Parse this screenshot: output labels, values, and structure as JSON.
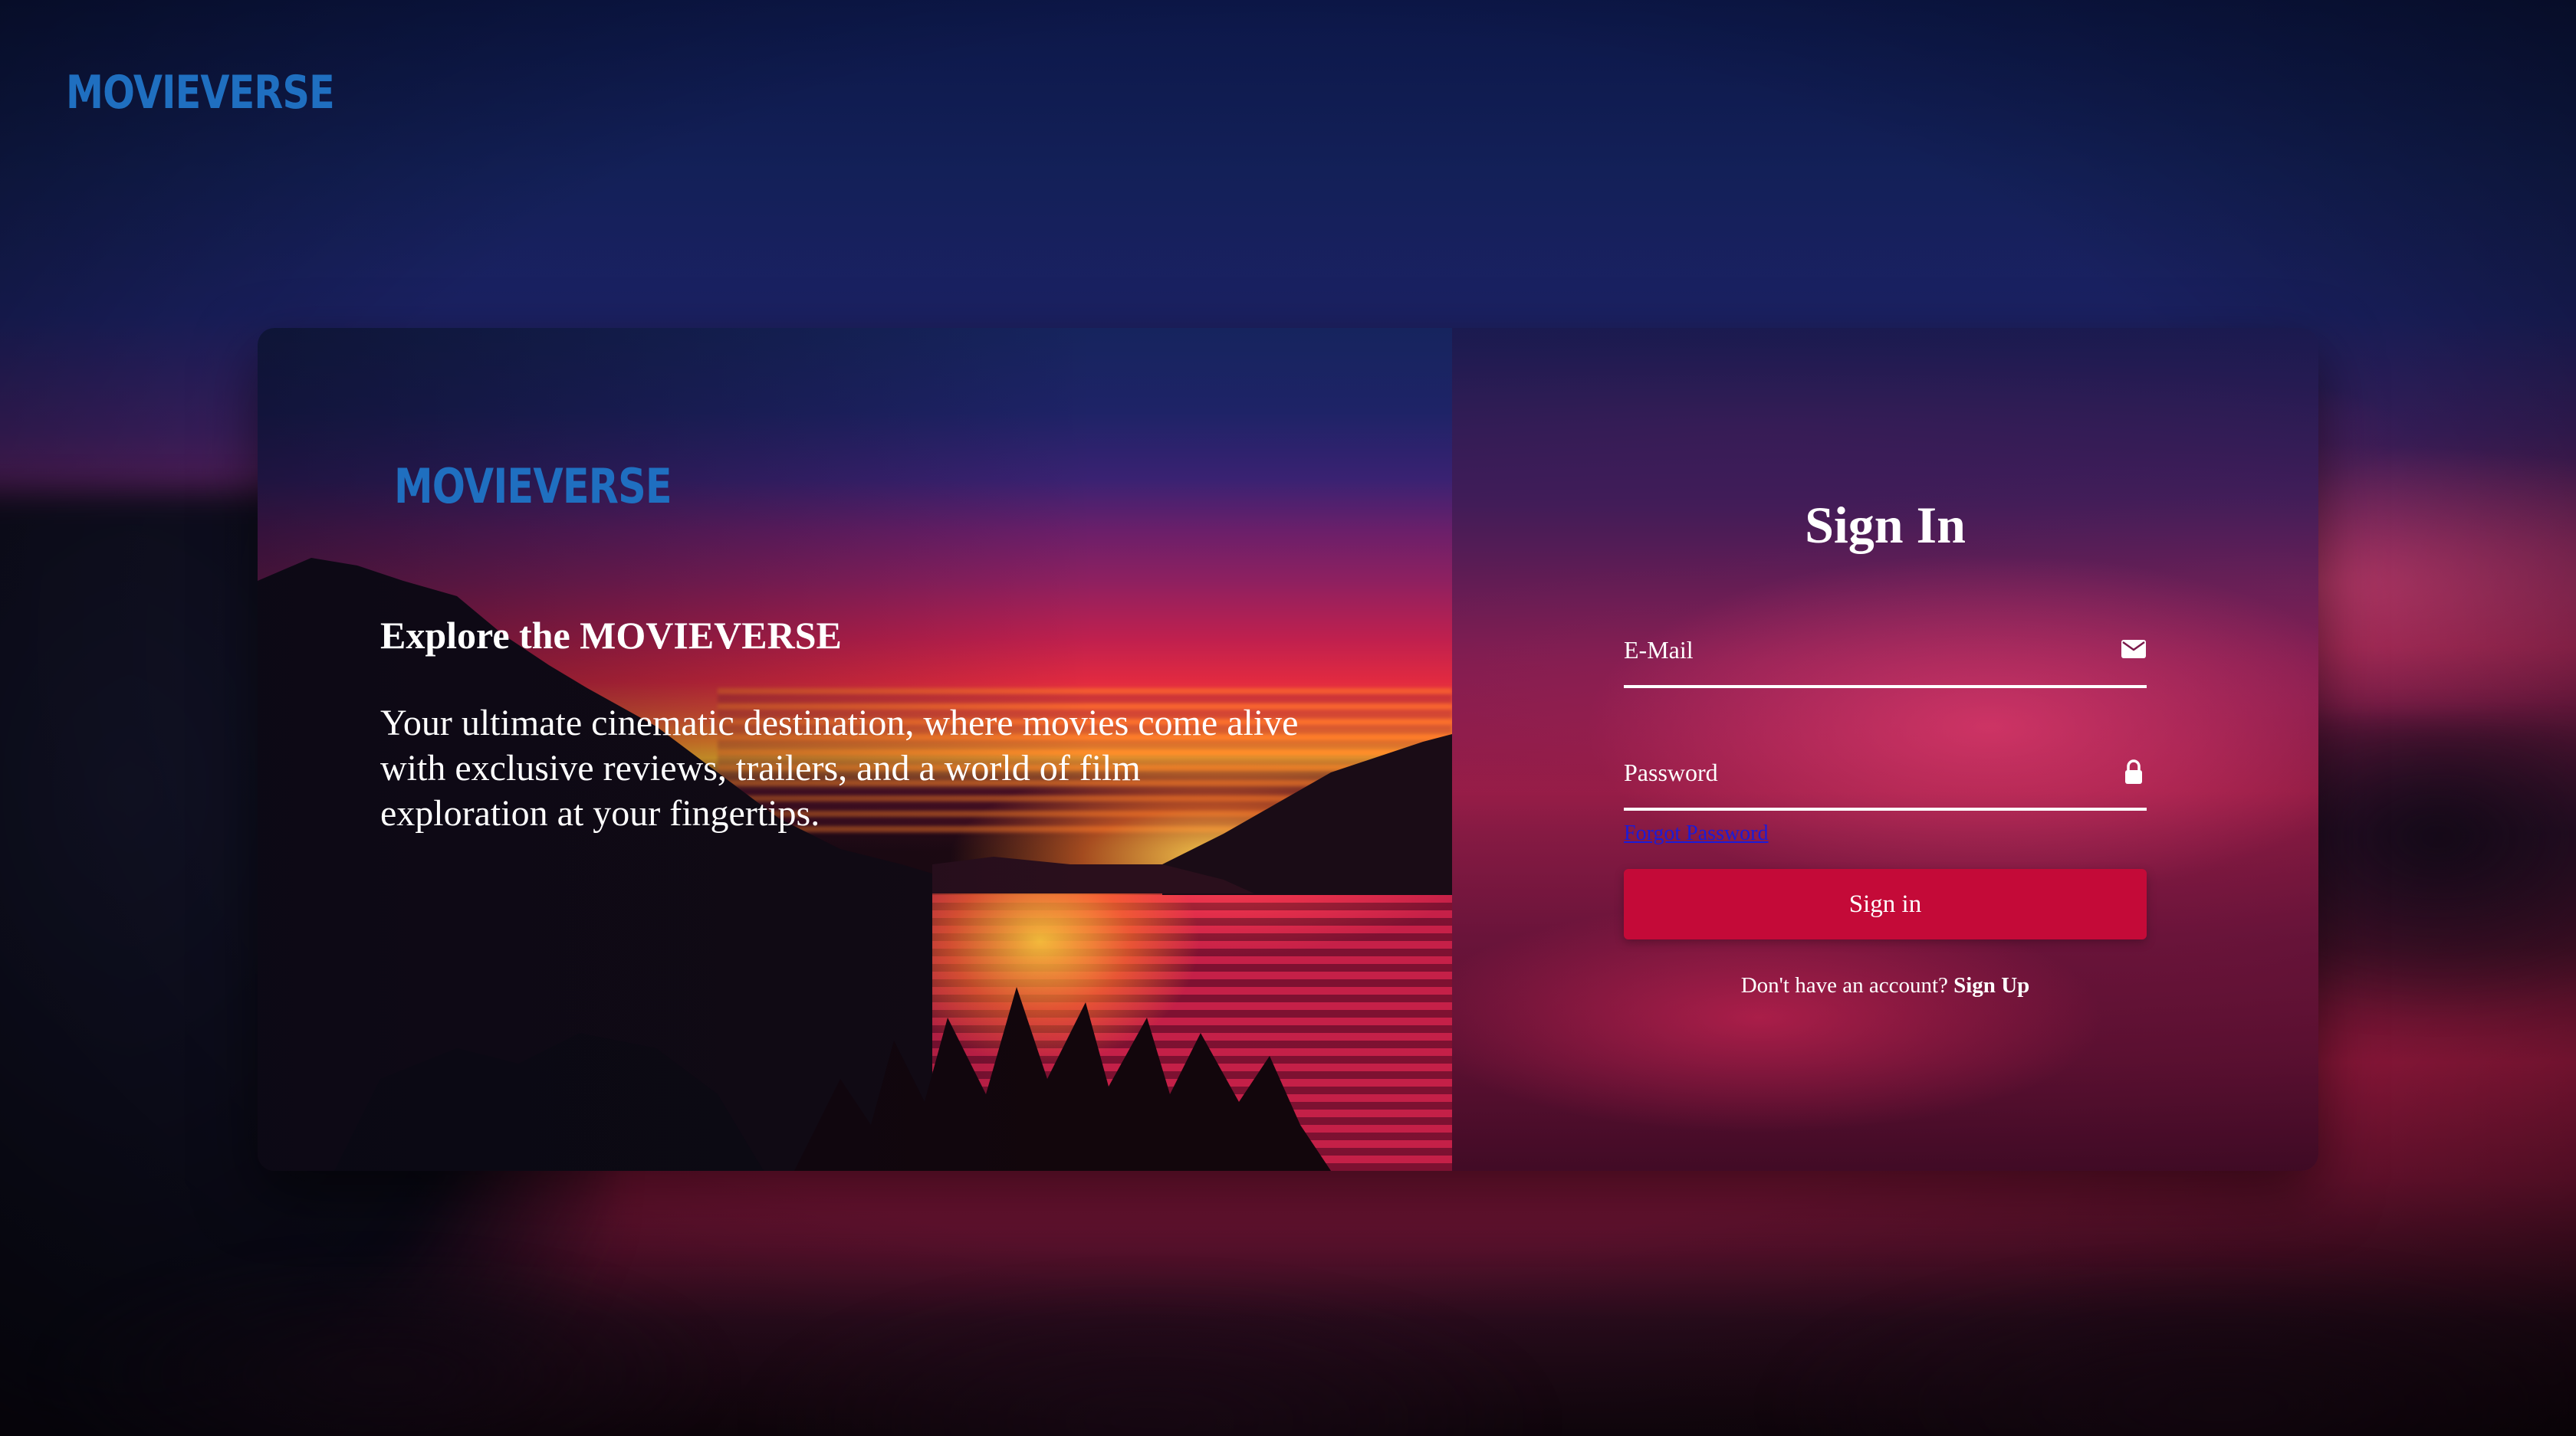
{
  "brand": {
    "logo_text": "MOVIEVERSE",
    "logo_color": "#1f6fc0"
  },
  "hero": {
    "title": "Explore the MOVIEVERSE",
    "description": "Your ultimate cinematic destination, where movies come alive with exclusive reviews, trailers, and a world of film exploration at your fingertips."
  },
  "form": {
    "title": "Sign In",
    "email_placeholder": "E-Mail",
    "email_icon": "mail-icon",
    "password_placeholder": "Password",
    "password_icon": "lock-icon",
    "forgot_label": "Forgot Password",
    "submit_label": "Sign in",
    "signup_prompt": "Don't have an account?",
    "signup_label": "Sign Up",
    "accent_color": "#c40a38"
  }
}
